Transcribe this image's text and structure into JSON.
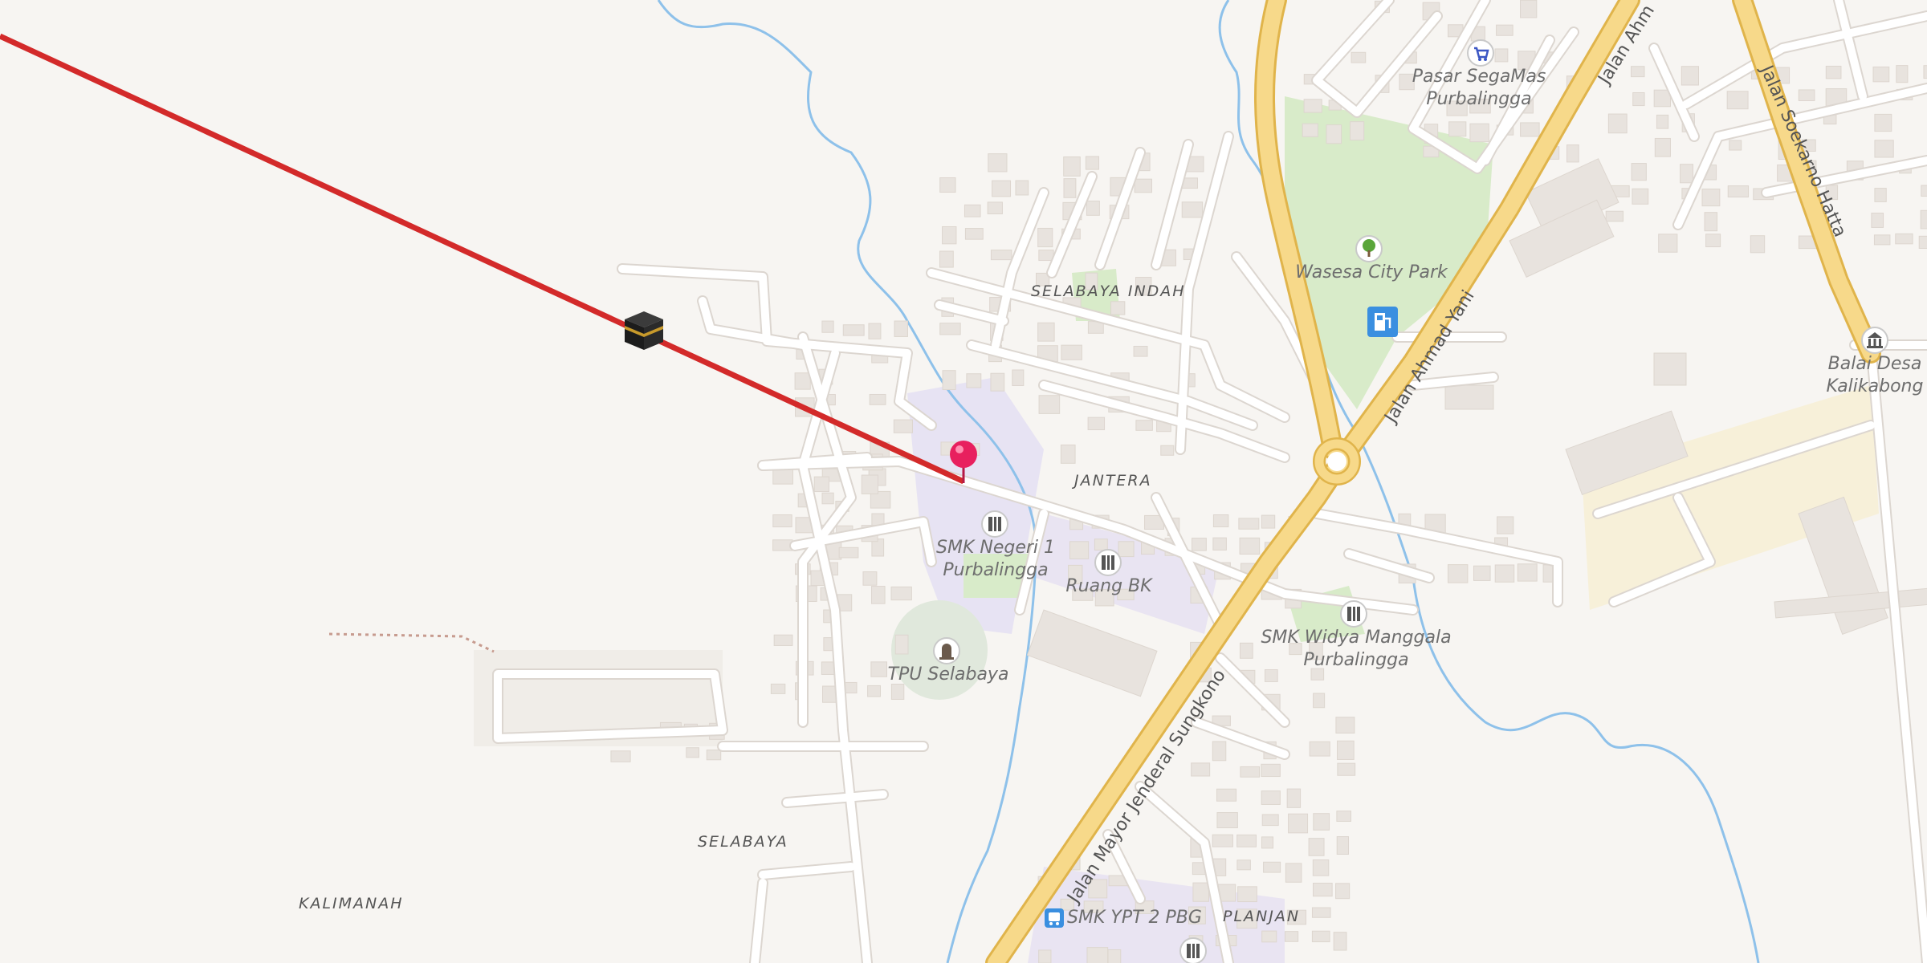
{
  "map": {
    "area_labels": {
      "selabaya_indah": "SELABAYA INDAH",
      "jantera": "JANTERA",
      "selabaya": "SELABAYA",
      "kalimanah": "KALIMANAH",
      "planjan": "PLANJAN"
    },
    "road_labels": {
      "ahmad_yani": "Jalan Ahmad Yani",
      "ahmad_yani_top": "Jalan Ahm",
      "sungkono": "Jalan Mayor Jenderal Sungkono",
      "soekarno_hatta": "Jalan Soekarno Hatta"
    },
    "pois": {
      "pasar": {
        "line1": "Pasar SegaMas",
        "line2": "Purbalingga",
        "icon": "shopping-cart-icon"
      },
      "wasesa": {
        "line1": "Wasesa City Park",
        "icon": "tree-icon"
      },
      "fuel": {
        "icon": "fuel-station-icon"
      },
      "balai": {
        "line1": "Balai Desa",
        "line2": "Kalikabong",
        "icon": "town-hall-icon"
      },
      "smk1": {
        "line1": "SMK Negeri 1",
        "line2": "Purbalingga",
        "icon": "school-icon"
      },
      "ruang": {
        "line1": "Ruang BK",
        "icon": "school-icon"
      },
      "widya": {
        "line1": "SMK Widya Manggala",
        "line2": "Purbalingga",
        "icon": "school-icon"
      },
      "tpu": {
        "line1": "TPU Selabaya",
        "icon": "cemetery-icon"
      },
      "ypt": {
        "line1": "SMK YPT 2 PBG",
        "icon": "bus-stop-icon"
      }
    },
    "markers": {
      "location_pin": "location-pin-icon",
      "kaaba": "kaaba-icon"
    },
    "colors": {
      "background": "#f7f5f2",
      "qibla_line": "#d32a2a",
      "main_road_fill": "#f7d98a",
      "main_road_casing": "#e0b44b",
      "minor_road": "#ffffff",
      "road_casing": "#dcd6d0",
      "building": "#e8e3de",
      "park": "#d8ebc9",
      "school_area": "#e7e3f3",
      "river": "#8ec1ea",
      "pin": "#e8205e"
    }
  }
}
